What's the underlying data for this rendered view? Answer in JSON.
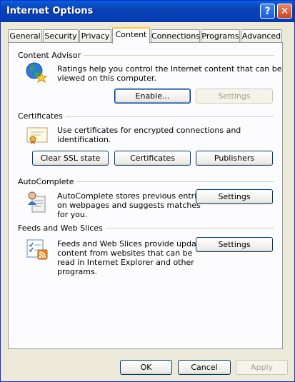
{
  "window": {
    "title": "Internet Options"
  },
  "title_buttons": {
    "help": "?",
    "close": "✕"
  },
  "tabs": [
    "General",
    "Security",
    "Privacy",
    "Content",
    "Connections",
    "Programs",
    "Advanced"
  ],
  "active_tab": "Content",
  "content_advisor": {
    "title": "Content Advisor",
    "desc_line1": "Ratings help you control the Internet content that can be",
    "desc_line2": "viewed on this computer.",
    "enable_button": "Enable...",
    "settings_button": "Settings",
    "icon": "globe-star-icon"
  },
  "certificates": {
    "title": "Certificates",
    "desc": "Use certificates for encrypted connections and identification.",
    "clear_ssl_button": "Clear SSL state",
    "certificates_button": "Certificates",
    "publishers_button": "Publishers",
    "icon": "certificate-icon"
  },
  "autocomplete": {
    "title": "AutoComplete",
    "desc_line1": "AutoComplete stores previous entries",
    "desc_line2": "on webpages and suggests matches",
    "desc_line3": "for you.",
    "settings_button": "Settings",
    "icon": "autocomplete-icon"
  },
  "feeds": {
    "title": "Feeds and Web Slices",
    "desc_line1": "Feeds and Web Slices provide updated",
    "desc_line2": "content from websites that can be",
    "desc_line3": "read in Internet Explorer and other",
    "desc_line4": "programs.",
    "settings_button": "Settings",
    "icon": "feeds-icon"
  },
  "footer": {
    "ok": "OK",
    "cancel": "Cancel",
    "apply": "Apply"
  }
}
